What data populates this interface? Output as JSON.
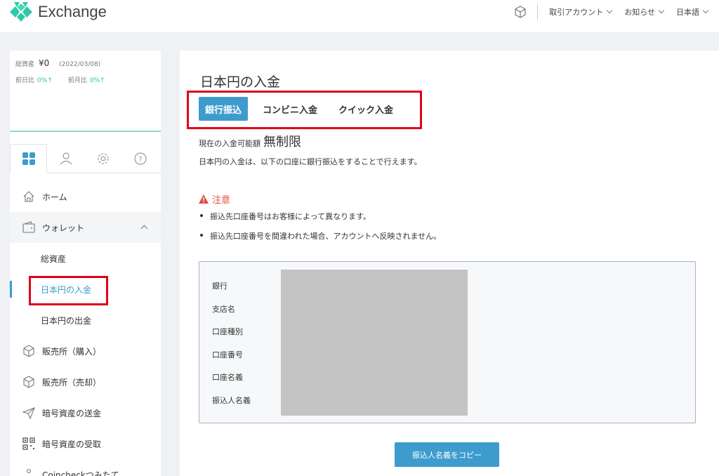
{
  "header": {
    "logo_text": "Exchange",
    "menus": [
      {
        "label": "取引アカウント"
      },
      {
        "label": "お知らせ"
      },
      {
        "label": "日本語"
      }
    ]
  },
  "sidebar": {
    "total_label": "総資産",
    "total_value": "¥0",
    "total_date": "(2022/03/08)",
    "prev_day_label": "前日比",
    "prev_day_value": "0%↑",
    "prev_month_label": "前月比",
    "prev_month_value": "0%↑",
    "tabs": [
      "dashboard-icon",
      "user-icon",
      "gear-icon",
      "help-icon"
    ],
    "nav": [
      {
        "label": "ホーム",
        "icon": "home-icon"
      },
      {
        "label": "ウォレット",
        "icon": "wallet-icon"
      },
      {
        "label": "総資産"
      },
      {
        "label": "日本円の入金"
      },
      {
        "label": "日本円の出金"
      },
      {
        "label": "販売所（購入）",
        "icon": "cube-icon"
      },
      {
        "label": "販売所（売却）",
        "icon": "cube-icon"
      },
      {
        "label": "暗号資産の送金",
        "icon": "send-icon"
      },
      {
        "label": "暗号資産の受取",
        "icon": "qr-icon"
      },
      {
        "label": "Coincheckつみたて",
        "icon": "nodes-icon"
      }
    ]
  },
  "main": {
    "title": "日本円の入金",
    "tabs": [
      "銀行振込",
      "コンビニ入金",
      "クイック入金"
    ],
    "limit_label": "現在の入金可能額",
    "limit_value": "無制限",
    "description": "日本円の入金は、以下の口座に銀行振込をすることで行えます。",
    "warning_title": "注意",
    "notes": [
      "振込先口座番号はお客様によって異なります。",
      "振込先口座番号を間違われた場合、アカウントへ反映されません。"
    ],
    "bank_labels": [
      "銀行",
      "支店名",
      "口座種別",
      "口座番号",
      "口座名義",
      "振込人名義"
    ],
    "copy_button": "振込人名義をコピー"
  },
  "colors": {
    "accent": "#3d9ccd",
    "logo_green": "#2fc9a8",
    "warning": "#e24c3e",
    "annotation": "#e2001a"
  }
}
